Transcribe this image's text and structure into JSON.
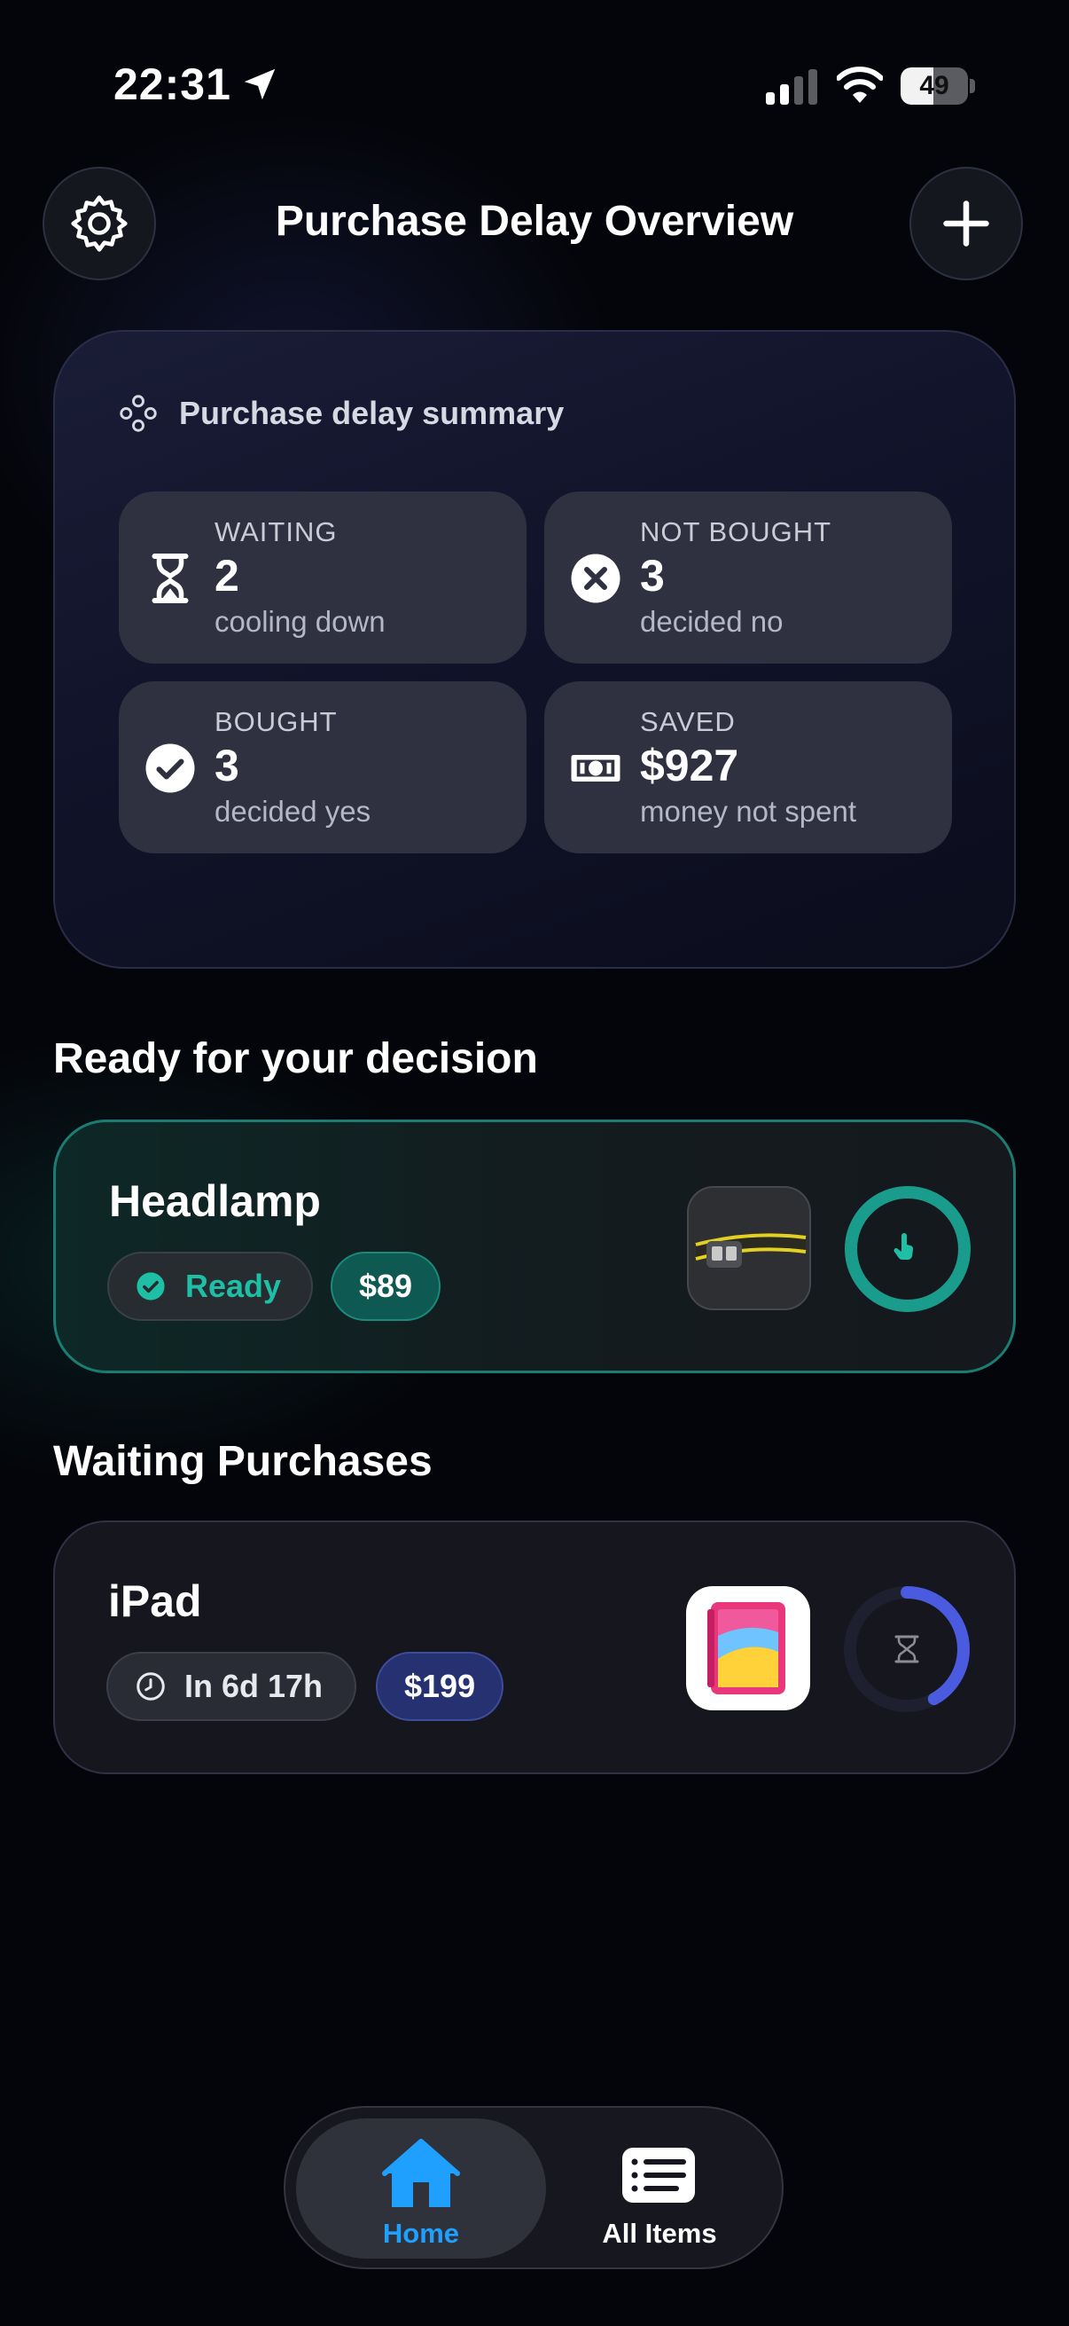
{
  "status_bar": {
    "time": "22:31",
    "battery": "49",
    "battery_level": 0.49
  },
  "header": {
    "title": "Purchase Delay Overview",
    "settings_icon": "gear-icon",
    "add_icon": "plus-icon"
  },
  "summary": {
    "title": "Purchase delay summary",
    "tiles": [
      {
        "label": "WAITING",
        "value": "2",
        "sub": "cooling down",
        "icon": "hourglass-icon"
      },
      {
        "label": "NOT BOUGHT",
        "value": "3",
        "sub": "decided no",
        "icon": "x-circle-icon"
      },
      {
        "label": "BOUGHT",
        "value": "3",
        "sub": "decided yes",
        "icon": "check-circle-icon"
      },
      {
        "label": "SAVED",
        "value": "$927",
        "sub": "money not spent",
        "icon": "banknote-icon"
      }
    ]
  },
  "ready_section": {
    "title": "Ready for your decision",
    "item": {
      "name": "Headlamp",
      "status": "Ready",
      "price": "$89",
      "ring_progress": 1.0,
      "ring_color": "#1a9c8c"
    }
  },
  "waiting_section": {
    "title": "Waiting Purchases",
    "item": {
      "name": "iPad",
      "time_left": "In 6d 17h",
      "price": "$199",
      "ring_progress": 0.42,
      "ring_color": "#4a5be0"
    }
  },
  "tabbar": {
    "tabs": [
      {
        "label": "Home",
        "icon": "house-icon",
        "selected": true,
        "color": "#1fa0ff"
      },
      {
        "label": "All Items",
        "icon": "list-icon",
        "selected": false
      }
    ]
  }
}
